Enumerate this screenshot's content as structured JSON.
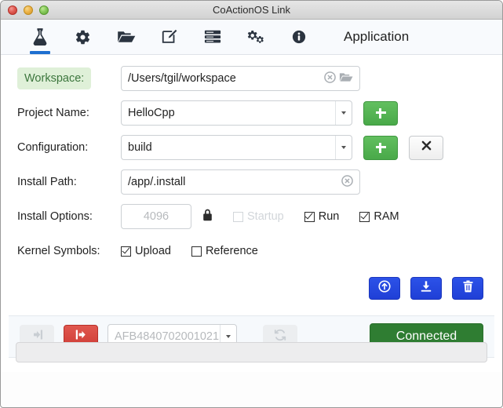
{
  "window": {
    "title": "CoActionOS Link",
    "controls": [
      {
        "name": "close-button",
        "color": "#e05c54"
      },
      {
        "name": "minimize-button",
        "color": "#eeb44a"
      },
      {
        "name": "zoom-button",
        "color": "#87ca5c"
      }
    ]
  },
  "tabbar": {
    "active_index": 0,
    "active_color": "#1d6fd0",
    "section_title": "Application",
    "tabs": [
      {
        "icon": "flask-icon",
        "name": "tab-application"
      },
      {
        "icon": "gear-icon",
        "name": "tab-settings"
      },
      {
        "icon": "folder-open-icon",
        "name": "tab-filesystem"
      },
      {
        "icon": "edit-icon",
        "name": "tab-editor"
      },
      {
        "icon": "list-icon",
        "name": "tab-terminal"
      },
      {
        "icon": "cogs-icon",
        "name": "tab-kernel"
      },
      {
        "icon": "info-icon",
        "name": "tab-about"
      }
    ]
  },
  "form": {
    "workspace": {
      "label": "Workspace:",
      "label_bg": "#dff0d8",
      "label_color": "#3c763d",
      "value": "/Users/tgil/workspace",
      "clear_icon": "clear-circle-icon",
      "browse_icon": "folder-open-icon"
    },
    "project_name": {
      "label": "Project Name:",
      "value": "HelloCpp",
      "add_label": "+"
    },
    "configuration": {
      "label": "Configuration:",
      "value": "build",
      "add_label": "+",
      "remove_label": "✖"
    },
    "install_path": {
      "label": "Install Path:",
      "value": "/app/.install",
      "clear_icon": "clear-circle-icon"
    },
    "install_options": {
      "label": "Install Options:",
      "ram_size_placeholder": "4096",
      "lock_icon": "lock-icon",
      "checkboxes": [
        {
          "label": "Startup",
          "checked": false,
          "enabled": false
        },
        {
          "label": "Run",
          "checked": true,
          "enabled": true
        },
        {
          "label": "RAM",
          "checked": true,
          "enabled": true
        }
      ]
    },
    "kernel_symbols": {
      "label": "Kernel Symbols:",
      "checkboxes": [
        {
          "label": "Upload",
          "checked": true,
          "enabled": true
        },
        {
          "label": "Reference",
          "checked": false,
          "enabled": true
        }
      ]
    }
  },
  "action_buttons": [
    {
      "name": "install-button",
      "icon": "upload-circle-icon",
      "color": "#2440d8"
    },
    {
      "name": "download-button",
      "icon": "download-icon",
      "color": "#2440d8"
    },
    {
      "name": "delete-button",
      "icon": "trash-icon",
      "color": "#2440d8"
    }
  ],
  "connection": {
    "connect_button": {
      "name": "connect-button",
      "icon": "sign-in-icon",
      "enabled": false
    },
    "disconnect_button": {
      "name": "disconnect-button",
      "icon": "sign-out-icon",
      "color": "#ce3b34",
      "enabled": true
    },
    "device_serial": "AFB4840702001021",
    "refresh_button": {
      "name": "refresh-button",
      "icon": "refresh-icon",
      "enabled": false
    },
    "status_label": "Connected",
    "status_color": "#2f7d32"
  },
  "statusbar": {
    "text": ""
  }
}
